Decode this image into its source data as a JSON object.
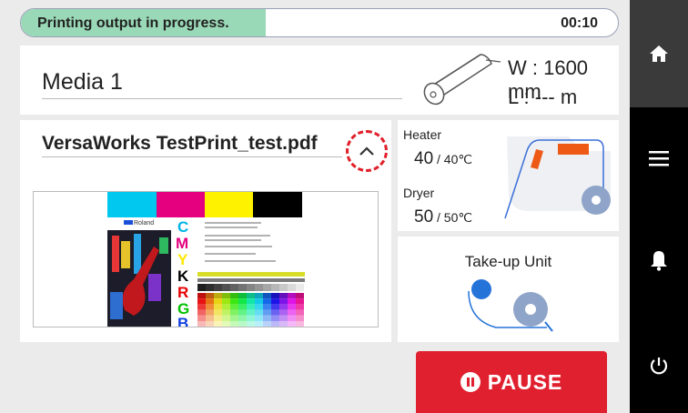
{
  "status": {
    "message": "Printing output in progress.",
    "time": "00:10",
    "progress": 0.41
  },
  "media": {
    "name": "Media 1",
    "width": "W : 1600 mm",
    "length": "L : --- m"
  },
  "job": {
    "filename": "VersaWorks TestPrint_test.pdf",
    "preview_brand": "Roland",
    "cmykrgb": [
      "C",
      "M",
      "Y",
      "K",
      "R",
      "G",
      "B"
    ]
  },
  "heater": {
    "label": "Heater",
    "value": "40",
    "setpoint": " / 40℃"
  },
  "dryer": {
    "label": "Dryer",
    "value": "50",
    "setpoint": " / 50℃"
  },
  "takeup": {
    "title": "Take-up Unit"
  },
  "pause": {
    "label": "PAUSE"
  },
  "sidebar": {
    "items": [
      "home-icon",
      "menu-icon",
      "bell-icon",
      "power-icon"
    ]
  },
  "colors": {
    "accent_red": "#e1202f",
    "progress_green": "#9ad9b7",
    "heater_orange": "#ee5a16",
    "takeup_blue": "#2473d8",
    "sidebar": "#000000"
  }
}
